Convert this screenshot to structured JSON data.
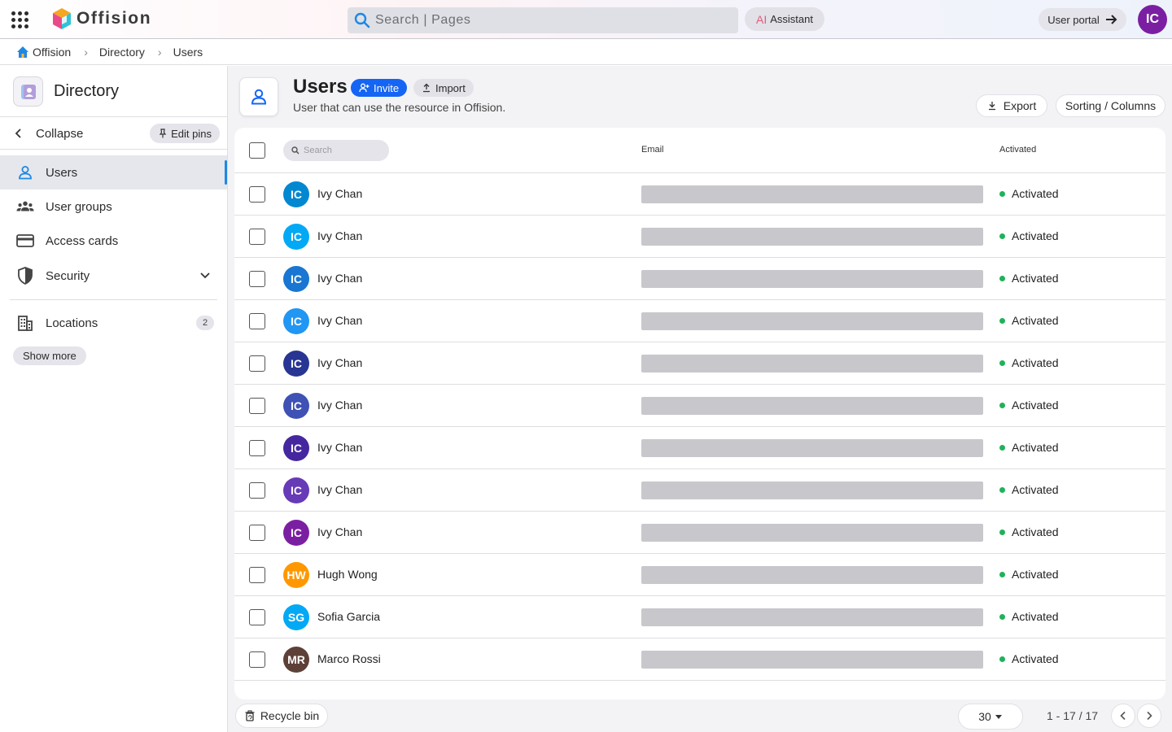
{
  "app": {
    "brand": "Offision",
    "search_placeholder": "Search | Pages",
    "assistant_ai": "AI",
    "assistant_label": "Assistant",
    "user_portal_label": "User portal",
    "user_initials": "IC",
    "user_avatar_color": "#7b1fa2"
  },
  "breadcrumb": [
    {
      "label": "Offision"
    },
    {
      "label": "Directory"
    },
    {
      "label": "Users"
    }
  ],
  "sidebar": {
    "title": "Directory",
    "collapse_label": "Collapse",
    "edit_pins_label": "Edit pins",
    "items": [
      {
        "label": "Users",
        "icon": "person-icon",
        "active": true
      },
      {
        "label": "User groups",
        "icon": "groups-icon"
      },
      {
        "label": "Access cards",
        "icon": "card-icon"
      },
      {
        "label": "Security",
        "icon": "shield-icon",
        "expandable": true
      },
      {
        "label": "Locations",
        "icon": "building-icon",
        "badge": "2"
      }
    ],
    "show_more_label": "Show more"
  },
  "page": {
    "title": "Users",
    "subtitle": "User that can use the resource in Offision.",
    "invite_label": "Invite",
    "import_label": "Import",
    "export_label": "Export",
    "sorting_label": "Sorting / Columns",
    "accent_color": "#1565f5"
  },
  "table": {
    "search_placeholder": "Search",
    "columns": {
      "email": "Email",
      "activated": "Activated"
    },
    "rows": [
      {
        "initials": "IC",
        "name": "Ivy Chan",
        "status": "Activated",
        "color": "#0288d1"
      },
      {
        "initials": "IC",
        "name": "Ivy Chan",
        "status": "Activated",
        "color": "#03a9f4"
      },
      {
        "initials": "IC",
        "name": "Ivy Chan",
        "status": "Activated",
        "color": "#1976d2"
      },
      {
        "initials": "IC",
        "name": "Ivy Chan",
        "status": "Activated",
        "color": "#2196f3"
      },
      {
        "initials": "IC",
        "name": "Ivy Chan",
        "status": "Activated",
        "color": "#283593"
      },
      {
        "initials": "IC",
        "name": "Ivy Chan",
        "status": "Activated",
        "color": "#3f51b5"
      },
      {
        "initials": "IC",
        "name": "Ivy Chan",
        "status": "Activated",
        "color": "#4527a0"
      },
      {
        "initials": "IC",
        "name": "Ivy Chan",
        "status": "Activated",
        "color": "#673ab7"
      },
      {
        "initials": "IC",
        "name": "Ivy Chan",
        "status": "Activated",
        "color": "#7b1fa2"
      },
      {
        "initials": "HW",
        "name": "Hugh Wong",
        "status": "Activated",
        "color": "#ff9800"
      },
      {
        "initials": "SG",
        "name": "Sofia Garcia",
        "status": "Activated",
        "color": "#03a9f4"
      },
      {
        "initials": "MR",
        "name": "Marco Rossi",
        "status": "Activated",
        "color": "#5d4037"
      }
    ]
  },
  "footer": {
    "recycle_bin_label": "Recycle bin",
    "page_size": "30",
    "page_info": "1 - 17 / 17"
  }
}
